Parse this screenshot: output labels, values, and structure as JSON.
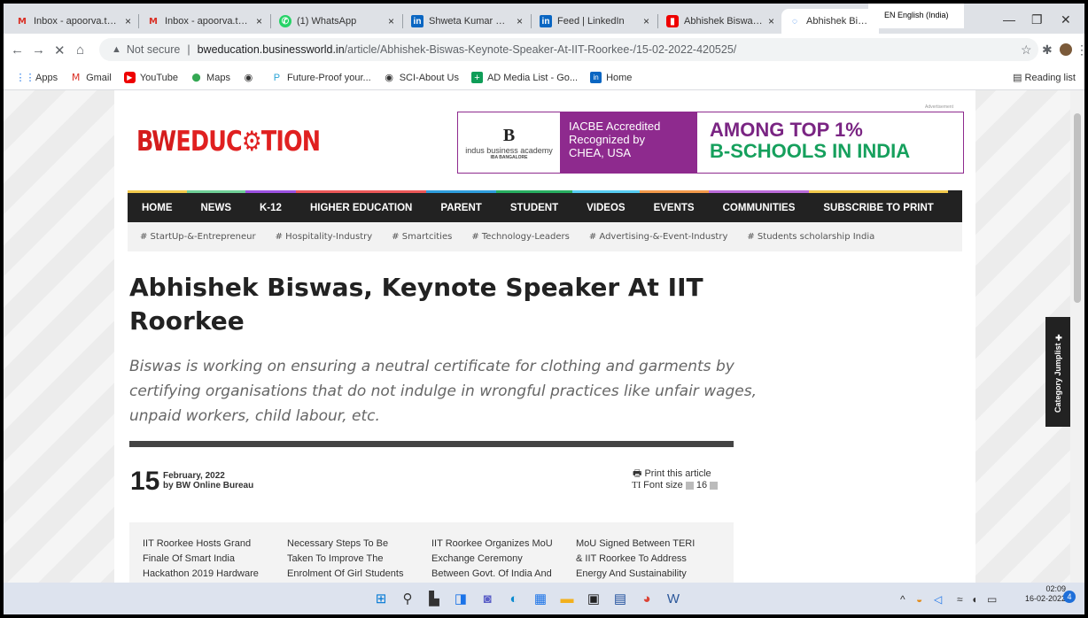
{
  "browser": {
    "tabs": [
      {
        "icon": "M",
        "label": "Inbox - apoorva.twen",
        "close": "×"
      },
      {
        "icon": "M",
        "label": "Inbox - apoorva.twen",
        "close": "×"
      },
      {
        "icon": "✆",
        "label": "(1) WhatsApp",
        "close": "×"
      },
      {
        "icon": "in",
        "label": "Shweta Kumar Devga",
        "close": "×"
      },
      {
        "icon": "in",
        "label": "Feed | LinkedIn",
        "close": "×"
      },
      {
        "icon": "▮",
        "label": "Abhishek Biswas and",
        "close": "×"
      },
      {
        "icon": "◌",
        "label": "Abhishek Biswas Ke",
        "close": ""
      }
    ],
    "language_popup": "EN English (India)",
    "window_controls": {
      "minimize": "—",
      "maximize": "❐",
      "close": "✕"
    },
    "nav": {
      "back": "←",
      "forward": "→",
      "stop": "✕",
      "home": "⌂"
    },
    "address": {
      "warning_icon": "▲",
      "security": "Not secure",
      "separator": "|",
      "domain": "bweducation.businessworld.in",
      "path": "/article/Abhishek-Biswas-Keynote-Speaker-At-IIT-Roorkee-/15-02-2022-420525/"
    },
    "right_icons": {
      "share": "⇪",
      "star": "☆",
      "extensions": "✱",
      "menu": "⋮"
    },
    "bookmarks": [
      {
        "icon": "⋮⋮",
        "label": "Apps"
      },
      {
        "icon": "M",
        "label": "Gmail"
      },
      {
        "icon": "▶",
        "label": "YouTube"
      },
      {
        "icon": "⬤",
        "label": "Maps"
      },
      {
        "icon": "◉",
        "label": ""
      },
      {
        "icon": "P",
        "label": "Future-Proof your..."
      },
      {
        "icon": "◉",
        "label": "SCI-About Us"
      },
      {
        "icon": "+",
        "label": "AD Media List - Go..."
      },
      {
        "icon": "in",
        "label": "Home"
      }
    ],
    "reading_list": "Reading list"
  },
  "page": {
    "logo": {
      "bw": "BW",
      "education": "EDUC⚙TION"
    },
    "ad": {
      "label": "Advertisement",
      "brand_b": "B",
      "brand_name": "indus business academy",
      "brand_sub": "IBA BANGALORE",
      "line1": "IACBE Accredited",
      "line2": "Recognized by",
      "line3": "CHEA, USA",
      "big1": "AMONG TOP 1%",
      "big2": "B-SCHOOLS IN INDIA"
    },
    "menu": [
      "HOME",
      "NEWS",
      "K-12",
      "HIGHER EDUCATION",
      "PARENT",
      "STUDENT",
      "VIDEOS",
      "EVENTS",
      "COMMUNITIES",
      "SUBSCRIBE TO PRINT"
    ],
    "tags": [
      "# StartUp-&-Entrepreneur",
      "# Hospitality-Industry",
      "# Smartcities",
      "# Technology-Leaders",
      "# Advertising-&-Event-Industry",
      "# Students scholarship India"
    ],
    "title": "Abhishek Biswas, Keynote Speaker At IIT Roorkee",
    "subtitle": "Biswas is working on ensuring a neutral certificate for clothing and garments by certifying organisations that do not indulge in wrongful practices like unfair wages, unpaid workers, child labour, etc.",
    "day": "15",
    "month_year": "February, 2022",
    "byline": "by BW Online Bureau",
    "print": "Print this article",
    "font_size_label": "Font size",
    "font_size": "16",
    "related": [
      "IIT Roorkee Hosts Grand Finale Of Smart India Hackathon 2019 Hardware",
      "Necessary Steps To Be Taken To Improve The Enrolment Of Girl Students",
      "IIT Roorkee Organizes MoU Exchange Ceremony Between Govt. Of India And",
      "MoU Signed Between TERI & IIT Roorkee To Address Energy And Sustainability"
    ],
    "jumplist": "Category Jumplist ✚"
  },
  "taskbar": {
    "clock_time": "02:09",
    "clock_date": "16-02-2022",
    "notifications": "4"
  }
}
